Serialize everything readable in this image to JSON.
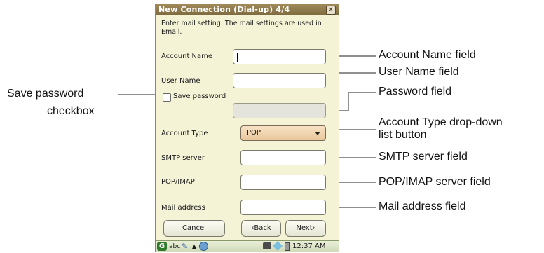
{
  "window": {
    "title": "New Connection (Dial-up) 4/4",
    "close_glyph": "×",
    "instructions": "Enter mail setting. The mail settings are used in Email."
  },
  "form": {
    "account_name": {
      "label": "Account Name",
      "value": ""
    },
    "user_name": {
      "label": "User Name",
      "value": ""
    },
    "save_password": {
      "label": "Save password",
      "checked": false
    },
    "password": {
      "value": "",
      "enabled": false
    },
    "account_type": {
      "label": "Account Type",
      "selected": "POP"
    },
    "smtp_server": {
      "label": "SMTP server",
      "value": ""
    },
    "pop_imap": {
      "label": "POP/IMAP",
      "value": ""
    },
    "mail_address": {
      "label": "Mail address",
      "value": ""
    }
  },
  "buttons": {
    "cancel": "Cancel",
    "back": "‹Back",
    "next": "Next›"
  },
  "taskbar": {
    "start_glyph": "G",
    "input_mode": "abc",
    "pen_glyph": "✎",
    "arrow_glyph": "▲",
    "clock": "12:37 AM"
  },
  "callouts": {
    "account_name": "Account Name field",
    "user_name": "User Name field",
    "password": "Password field",
    "account_type_line1": "Account Type drop-down",
    "account_type_line2": "list button",
    "smtp": "SMTP server field",
    "pop_imap": "POP/IMAP server field",
    "mail_address": "Mail address field",
    "save_password_line1": "Save password",
    "save_password_line2": "checkbox"
  },
  "colors": {
    "window_bg": "#f4f3d6",
    "titlebar": "#7d6a3e",
    "dropdown": "#e8c89c"
  }
}
